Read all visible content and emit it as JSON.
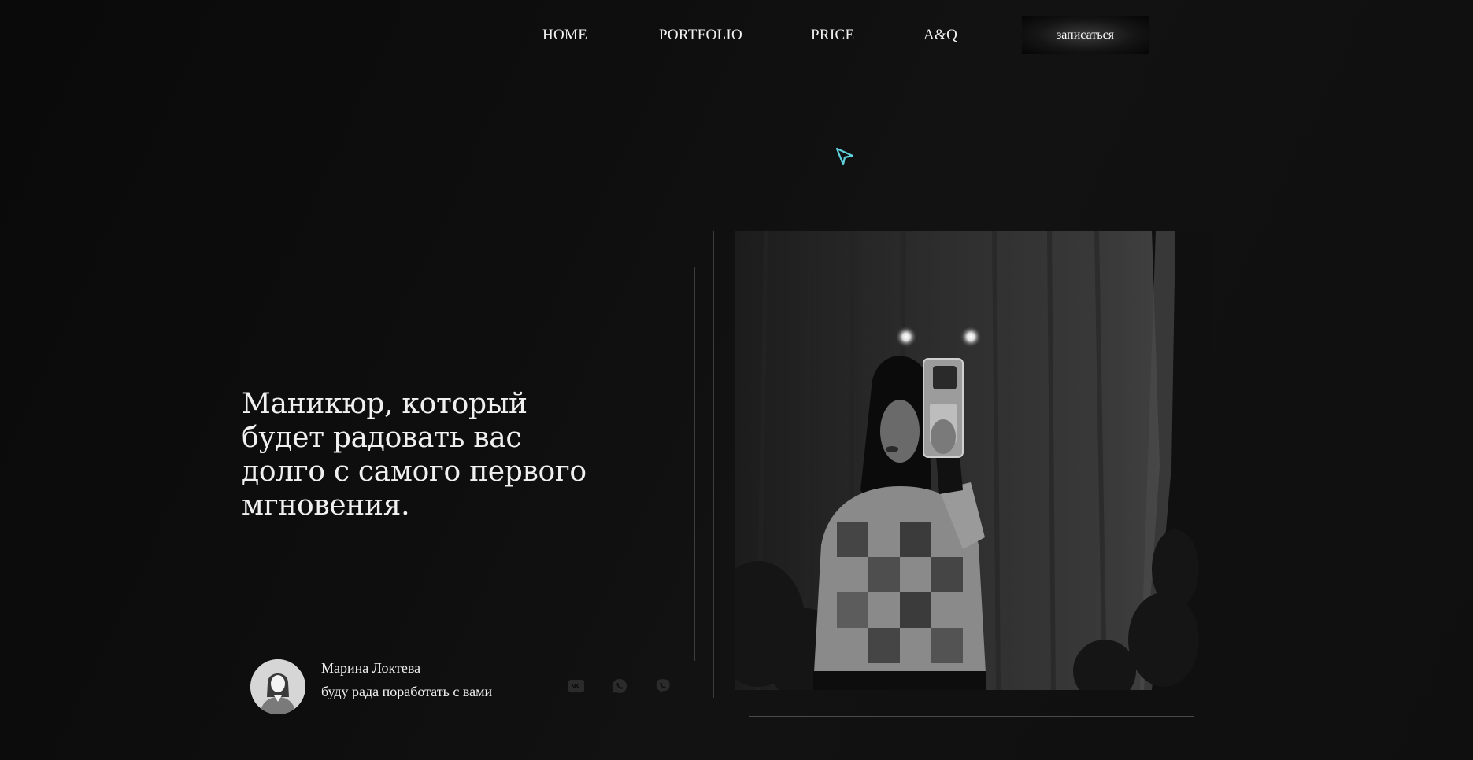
{
  "nav": {
    "items": [
      {
        "label": "HOME"
      },
      {
        "label": "PORTFOLIO"
      },
      {
        "label": "PRICE"
      },
      {
        "label": "A&Q"
      }
    ],
    "cta_label": "записаться"
  },
  "hero": {
    "headline": "Маникюр, который будет радовать вас долго с самого первого мгновения."
  },
  "profile": {
    "name": "Марина Локтева",
    "tagline": "буду рада поработать с вами"
  },
  "social": {
    "icons": [
      "vk-icon",
      "whatsapp-icon",
      "viber-icon"
    ]
  },
  "photo": {
    "subject": "mirror-selfie"
  },
  "colors": {
    "background": "#0d0d0d",
    "text": "#f0f0f0",
    "cursor": "#5fd3e0"
  }
}
